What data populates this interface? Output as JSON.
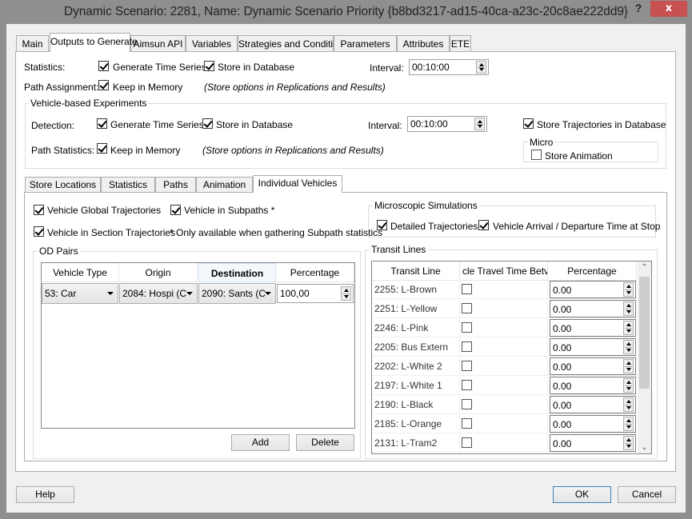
{
  "window": {
    "title": "Dynamic Scenario: 2281, Name: Dynamic Scenario Priority  {b8bd3217-ad15-40ca-a23c-20c8ae222dd9}",
    "help_glyph": "?",
    "close_glyph": "x"
  },
  "tabs": [
    {
      "label": "Main",
      "active": false
    },
    {
      "label": "Outputs to Generate",
      "active": true
    },
    {
      "label": "Aimsun API",
      "active": false
    },
    {
      "label": "Variables",
      "active": false
    },
    {
      "label": "Strategies and Conditions",
      "active": false
    },
    {
      "label": "Parameters",
      "active": false
    },
    {
      "label": "Attributes",
      "active": false
    },
    {
      "label": "ETE",
      "active": false
    }
  ],
  "statistics": {
    "label": "Statistics:",
    "generate_time_series": {
      "label": "Generate Time Series",
      "checked": true
    },
    "store_in_database": {
      "label": "Store in Database",
      "checked": true
    },
    "interval_label": "Interval:",
    "interval_value": "00:10:00"
  },
  "path_assignment": {
    "label": "Path Assignment:",
    "keep_in_memory": {
      "label": "Keep in Memory",
      "checked": true
    },
    "note": "(Store options in Replications and Results)"
  },
  "vehicle_experiments": {
    "title": "Vehicle-based Experiments",
    "detection": {
      "label": "Detection:",
      "generate_time_series": {
        "label": "Generate Time Series",
        "checked": true
      },
      "store_in_database": {
        "label": "Store in Database",
        "checked": true
      },
      "interval_label": "Interval:",
      "interval_value": "00:10:00"
    },
    "path_statistics": {
      "label": "Path Statistics:",
      "keep_in_memory": {
        "label": "Keep in Memory",
        "checked": true
      },
      "note": "(Store options in Replications and Results)"
    },
    "store_trajectories": {
      "label": "Store Trajectories in Database",
      "checked": true
    },
    "micro": {
      "title": "Micro",
      "store_animation": {
        "label": "Store Animation",
        "checked": false
      }
    }
  },
  "inner_tabs": [
    {
      "label": "Store Locations",
      "active": false
    },
    {
      "label": "Statistics",
      "active": false
    },
    {
      "label": "Paths",
      "active": false
    },
    {
      "label": "Animation",
      "active": false
    },
    {
      "label": "Individual Vehicles",
      "active": true
    }
  ],
  "individual_vehicles": {
    "global_trajectories": {
      "label": "Vehicle Global Trajectories",
      "checked": true
    },
    "in_subpaths": {
      "label": "Vehicle in Subpaths *",
      "checked": true
    },
    "section_trajectories": {
      "label": "Vehicle in Section Trajectories",
      "checked": true
    },
    "subpath_note": "* Only available when gathering Subpath statistics",
    "od_pairs": {
      "title": "OD Pairs",
      "columns": [
        "Vehicle Type",
        "Origin",
        "Destination",
        "Percentage"
      ],
      "rows": [
        {
          "vehicle_type": "53: Car",
          "origin": "2084: Hospi (C",
          "destination": "2090: Sants (C",
          "percentage": "100,00"
        }
      ],
      "add_label": "Add",
      "delete_label": "Delete"
    },
    "microscopic": {
      "title": "Microscopic Simulations",
      "detailed_trajectories": {
        "label": "Detailed Trajectories",
        "checked": true
      },
      "arrival_departure": {
        "label": "Vehicle Arrival / Departure Time at Stop",
        "checked": true
      }
    },
    "transit_lines": {
      "title": "Transit Lines",
      "columns": [
        "Transit Line",
        "cle Travel Time Betv",
        "Percentage"
      ],
      "rows": [
        {
          "line": "2255: L-Brown",
          "checked": false,
          "percentage": "0.00"
        },
        {
          "line": "2251: L-Yellow",
          "checked": false,
          "percentage": "0.00"
        },
        {
          "line": "2246: L-Pink",
          "checked": false,
          "percentage": "0.00"
        },
        {
          "line": "2205: Bus Extern",
          "checked": false,
          "percentage": "0.00"
        },
        {
          "line": "2202: L-White 2",
          "checked": false,
          "percentage": "0.00"
        },
        {
          "line": "2197: L-White 1",
          "checked": false,
          "percentage": "0.00"
        },
        {
          "line": "2190: L-Black",
          "checked": false,
          "percentage": "0.00"
        },
        {
          "line": "2185: L-Orange",
          "checked": false,
          "percentage": "0.00"
        },
        {
          "line": "2131: L-Tram2",
          "checked": false,
          "percentage": "0.00"
        }
      ]
    }
  },
  "footer": {
    "help_label": "Help",
    "ok_label": "OK",
    "cancel_label": "Cancel"
  },
  "colors": {
    "close_button": "#c75050",
    "default_button_border": "#3c7fb1",
    "frame": "#8f8f8f"
  }
}
